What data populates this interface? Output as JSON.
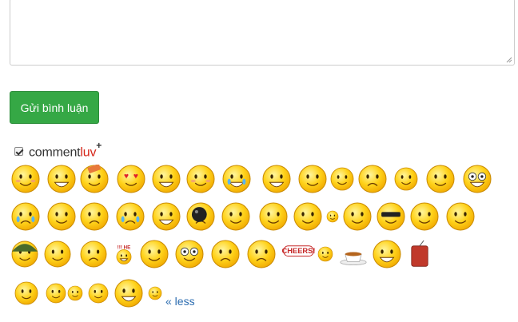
{
  "comment_form": {
    "textarea_value": "",
    "submit_label": "Gửi bình luận"
  },
  "commentluv": {
    "checked": true,
    "brand_main": "comment",
    "brand_accent": "luv",
    "brand_plus": "+"
  },
  "smileys": {
    "toggle_label": "« less",
    "rows": [
      [
        "shy",
        "grimace",
        "bandaged",
        "love-eyes",
        "laughing",
        "kiss",
        "crying-loud",
        "grin",
        "sleepy",
        "peace-sign",
        "sulky",
        "monkey",
        "angry",
        "shocked"
      ],
      [
        "sweating",
        "smug",
        "frown",
        "tears",
        "happy",
        "bomb",
        "wink",
        "tongue",
        "thinking",
        "small-wave",
        "peek",
        "cool",
        "smirk",
        "tiny-smile"
      ],
      [
        "soldier",
        "drummer",
        "worried",
        "cheer-text",
        "clapping",
        "pop-eye",
        "nervous",
        "unamused",
        "cheers-banner",
        "poke",
        "tea-cup",
        "big-grin",
        "dynamite"
      ],
      [
        "band-drums",
        "guitarist",
        "small-guitar",
        "rocker",
        "yawning",
        "plain-smile"
      ]
    ]
  }
}
